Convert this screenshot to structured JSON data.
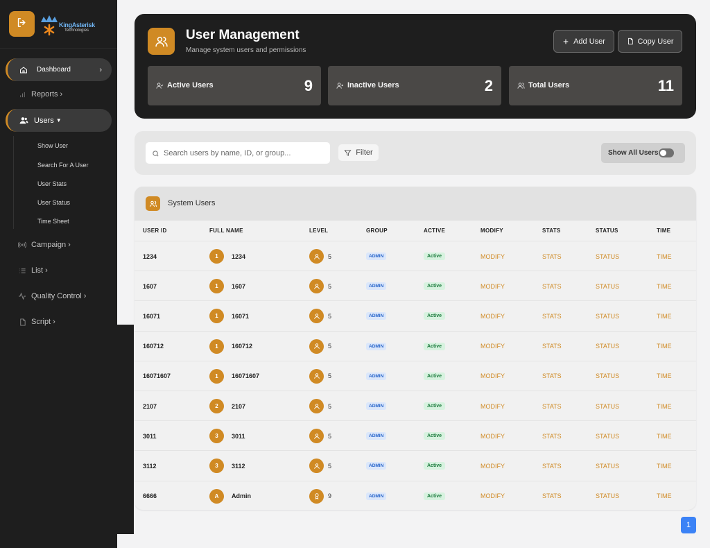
{
  "brand": {
    "name": "KingAsterisk",
    "sub": "Technologies"
  },
  "sidebar": {
    "dashboard": "Dashboard",
    "reports": "Reports",
    "users": "Users",
    "users_sub": [
      "Show User",
      "Search For A User",
      "User Stats",
      "User Status",
      "Time Sheet"
    ],
    "campaign": "Campaign",
    "list": "List",
    "quality_control": "Quality Control",
    "script": "Script"
  },
  "header": {
    "title": "User Management",
    "subtitle": "Manage system users and permissions",
    "add_user": "Add User",
    "copy_user": "Copy User"
  },
  "stats": [
    {
      "label": "Active Users",
      "value": "9"
    },
    {
      "label": "Inactive Users",
      "value": "2"
    },
    {
      "label": "Total Users",
      "value": "11"
    }
  ],
  "search": {
    "placeholder": "Search users by name, ID, or group...",
    "filter": "Filter",
    "show_all": "Show All Users"
  },
  "table": {
    "title": "System Users",
    "columns": [
      "USER ID",
      "FULL NAME",
      "LEVEL",
      "GROUP",
      "ACTIVE",
      "MODIFY",
      "STATS",
      "STATUS",
      "TIME"
    ],
    "rows": [
      {
        "user_id": "1234",
        "avatar": "1",
        "full_name": "1234",
        "level": "5",
        "group": "ADMIN",
        "active": "Active",
        "modify": "MODIFY",
        "stats": "STATS",
        "status": "STATUS",
        "time": "TIME"
      },
      {
        "user_id": "1607",
        "avatar": "1",
        "full_name": "1607",
        "level": "5",
        "group": "ADMIN",
        "active": "Active",
        "modify": "MODIFY",
        "stats": "STATS",
        "status": "STATUS",
        "time": "TIME"
      },
      {
        "user_id": "16071",
        "avatar": "1",
        "full_name": "16071",
        "level": "5",
        "group": "ADMIN",
        "active": "Active",
        "modify": "MODIFY",
        "stats": "STATS",
        "status": "STATUS",
        "time": "TIME"
      },
      {
        "user_id": "160712",
        "avatar": "1",
        "full_name": "160712",
        "level": "5",
        "group": "ADMIN",
        "active": "Active",
        "modify": "MODIFY",
        "stats": "STATS",
        "status": "STATUS",
        "time": "TIME"
      },
      {
        "user_id": "16071607",
        "avatar": "1",
        "full_name": "16071607",
        "level": "5",
        "group": "ADMIN",
        "active": "Active",
        "modify": "MODIFY",
        "stats": "STATS",
        "status": "STATUS",
        "time": "TIME"
      },
      {
        "user_id": "2107",
        "avatar": "2",
        "full_name": "2107",
        "level": "5",
        "group": "ADMIN",
        "active": "Active",
        "modify": "MODIFY",
        "stats": "STATS",
        "status": "STATUS",
        "time": "TIME"
      },
      {
        "user_id": "3011",
        "avatar": "3",
        "full_name": "3011",
        "level": "5",
        "group": "ADMIN",
        "active": "Active",
        "modify": "MODIFY",
        "stats": "STATS",
        "status": "STATUS",
        "time": "TIME"
      },
      {
        "user_id": "3112",
        "avatar": "3",
        "full_name": "3112",
        "level": "5",
        "group": "ADMIN",
        "active": "Active",
        "modify": "MODIFY",
        "stats": "STATS",
        "status": "STATUS",
        "time": "TIME"
      },
      {
        "user_id": "6666",
        "avatar": "A",
        "full_name": "Admin",
        "level": "9",
        "group": "ADMIN",
        "active": "Active",
        "modify": "MODIFY",
        "stats": "STATS",
        "status": "STATUS",
        "time": "TIME"
      }
    ]
  },
  "pagination": {
    "current": "1"
  },
  "colors": {
    "accent": "#d08a24",
    "sidebar": "#1e1e1e",
    "page_button": "#3b82f6"
  }
}
